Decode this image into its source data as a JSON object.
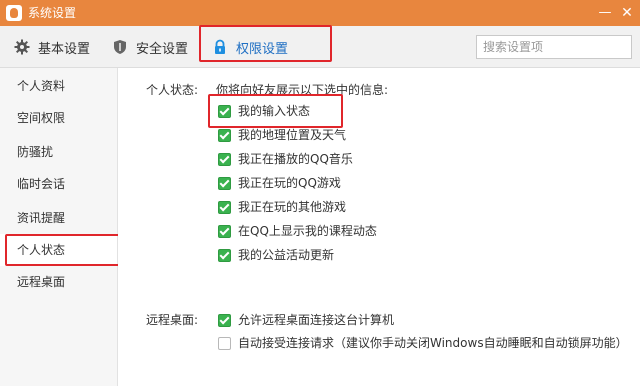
{
  "window": {
    "title": "系统设置",
    "minimize": "—",
    "close": "✕"
  },
  "toolbar": {
    "tabs": [
      {
        "label": "基本设置",
        "icon": "gear-icon"
      },
      {
        "label": "安全设置",
        "icon": "shield-icon"
      },
      {
        "label": "权限设置",
        "icon": "lock-icon",
        "active": true
      }
    ],
    "search_placeholder": "搜索设置项"
  },
  "sidebar": {
    "items": [
      {
        "label": "个人资料"
      },
      {
        "label": "空间权限"
      },
      {
        "label": "防骚扰"
      },
      {
        "label": "临时会话"
      },
      {
        "label": "资讯提醒"
      },
      {
        "label": "个人状态",
        "active": true
      },
      {
        "label": "远程桌面"
      }
    ]
  },
  "personal_status": {
    "label": "个人状态:",
    "hint": "你将向好友展示以下选中的信息:",
    "options": [
      {
        "label": "我的输入状态",
        "checked": true
      },
      {
        "label": "我的地理位置及天气",
        "checked": true
      },
      {
        "label": "我正在播放的QQ音乐",
        "checked": true
      },
      {
        "label": "我正在玩的QQ游戏",
        "checked": true
      },
      {
        "label": "我正在玩的其他游戏",
        "checked": true
      },
      {
        "label": "在QQ上显示我的课程动态",
        "checked": true
      },
      {
        "label": "我的公益活动更新",
        "checked": true
      }
    ]
  },
  "remote_desktop": {
    "label": "远程桌面:",
    "options": [
      {
        "label": "允许远程桌面连接这台计算机",
        "checked": true
      },
      {
        "label": "自动接受连接请求（建议你手动关闭Windows自动睡眠和自动锁屏功能）",
        "checked": false
      }
    ]
  },
  "colors": {
    "titlebar": "#e8863e",
    "accent": "#1f6fc3",
    "highlight": "#e0262b",
    "checkbox": "#3ab24f"
  }
}
